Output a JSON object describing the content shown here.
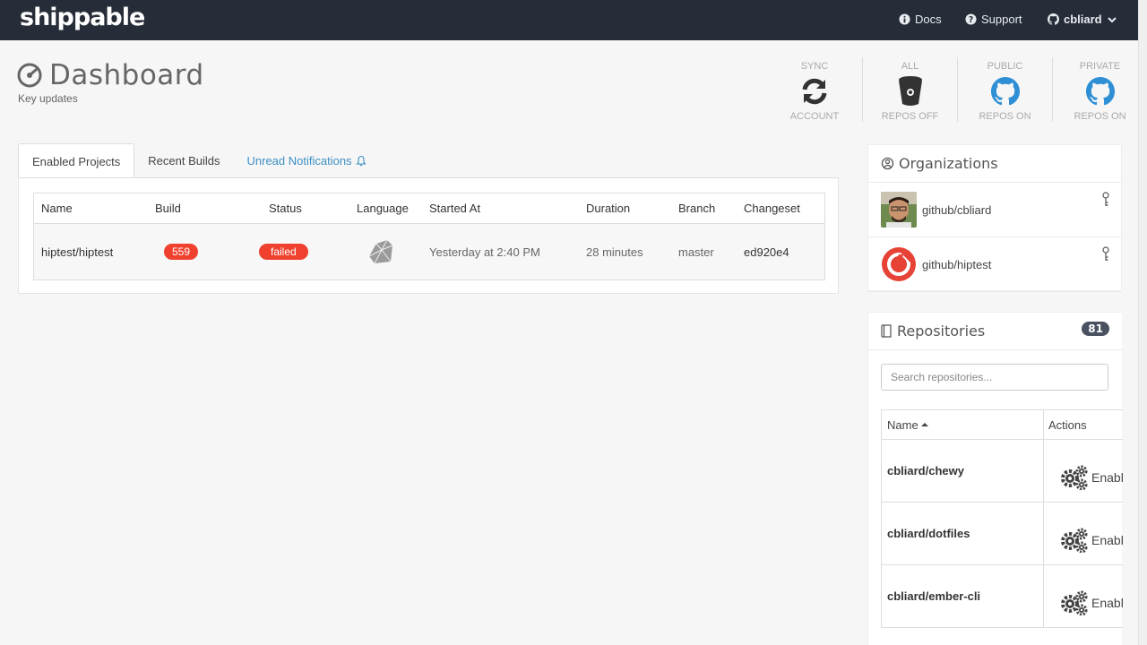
{
  "nav": {
    "logo": "shippable",
    "docs": "Docs",
    "support": "Support",
    "user": "cbliard"
  },
  "header": {
    "title": "Dashboard",
    "subtitle": "Key updates"
  },
  "stats": [
    {
      "top": "SYNC",
      "bottom": "ACCOUNT",
      "icon": "sync-icon"
    },
    {
      "top": "ALL",
      "bottom": "REPOS OFF",
      "icon": "bitbucket-icon"
    },
    {
      "top": "PUBLIC",
      "bottom": "REPOS ON",
      "icon": "github-icon"
    },
    {
      "top": "PRIVATE",
      "bottom": "REPOS ON",
      "icon": "github-icon"
    }
  ],
  "tabs": {
    "enabled": "Enabled Projects",
    "recent": "Recent Builds",
    "notifications": "Unread Notifications"
  },
  "projects": {
    "columns": [
      "Name",
      "Build",
      "Status",
      "Language",
      "Started At",
      "Duration",
      "Branch",
      "Changeset"
    ],
    "rows": [
      {
        "name": "hiptest/hiptest",
        "build": "559",
        "status": "failed",
        "language": "ruby-icon",
        "started": "Yesterday at 2:40 PM",
        "duration": "28 minutes",
        "branch": "master",
        "changeset": "ed920e4"
      }
    ]
  },
  "organizations": {
    "title": "Organizations",
    "items": [
      {
        "name": "github/cbliard"
      },
      {
        "name": "github/hiptest"
      }
    ]
  },
  "repositories": {
    "title": "Repositories",
    "count": "81",
    "search_placeholder": "Search repositories...",
    "col_name": "Name",
    "col_actions": "Actions",
    "enable_label": "Enable",
    "items": [
      {
        "name": "cbliard/chewy"
      },
      {
        "name": "cbliard/dotfiles"
      },
      {
        "name": "cbliard/ember-cli"
      }
    ]
  },
  "colors": {
    "nav_bg": "#262d38",
    "failed": "#f0412e",
    "link": "#3d8fc3",
    "github_blue": "#2f8fd5"
  }
}
